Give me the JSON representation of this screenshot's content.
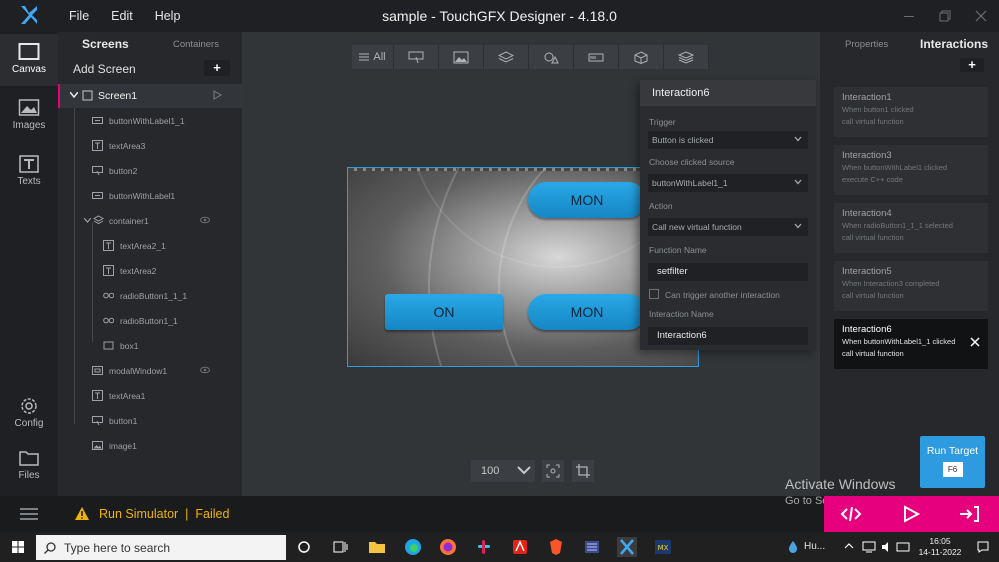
{
  "app": {
    "window_title": "sample - TouchGFX Designer - 4.18.0",
    "menu": [
      "File",
      "Edit",
      "Help"
    ]
  },
  "rail": {
    "items": [
      {
        "label": "Canvas",
        "icon": "canvas-icon"
      },
      {
        "label": "Images",
        "icon": "image-icon"
      },
      {
        "label": "Texts",
        "icon": "text-icon"
      },
      {
        "label": "Config",
        "icon": "gear-icon"
      },
      {
        "label": "Files",
        "icon": "folder-icon"
      }
    ]
  },
  "screens_panel": {
    "tab_screens": "Screens",
    "tab_containers": "Containers",
    "add_screen": "Add Screen",
    "add_symbol": "+",
    "tree": [
      {
        "label": "Screen1",
        "icon": "screen-icon",
        "selected": true
      },
      {
        "label": "buttonWithLabel1_1",
        "icon": "button-label-icon"
      },
      {
        "label": "textArea3",
        "icon": "textarea-icon"
      },
      {
        "label": "button2",
        "icon": "button-icon"
      },
      {
        "label": "buttonWithLabel1",
        "icon": "button-label-icon"
      },
      {
        "label": "container1",
        "icon": "container-icon"
      },
      {
        "label": "textArea2_1",
        "icon": "textarea-icon"
      },
      {
        "label": "textArea2",
        "icon": "textarea-icon"
      },
      {
        "label": "radioButton1_1_1",
        "icon": "radio-icon"
      },
      {
        "label": "radioButton1_1",
        "icon": "radio-icon"
      },
      {
        "label": "box1",
        "icon": "box-icon"
      },
      {
        "label": "modalWindow1",
        "icon": "modal-icon"
      },
      {
        "label": "textArea1",
        "icon": "textarea-icon"
      },
      {
        "label": "button1",
        "icon": "button-icon"
      },
      {
        "label": "image1",
        "icon": "image-icon"
      }
    ]
  },
  "toolbar": {
    "all_label": "All"
  },
  "stage": {
    "buttons": [
      "MON",
      "ON",
      "MON"
    ]
  },
  "zoom": {
    "value": "100"
  },
  "editor": {
    "title": "Interaction6",
    "trigger_label": "Trigger",
    "trigger_value": "Button is clicked",
    "source_label": "Choose clicked source",
    "source_value": "buttonWithLabel1_1",
    "action_label": "Action",
    "action_value": "Call new virtual function",
    "function_label": "Function Name",
    "function_value": "setfilter",
    "check_label": "Can trigger another interaction",
    "name_label": "Interaction Name",
    "name_value": "Interaction6"
  },
  "right_panel": {
    "tab_properties": "Properties",
    "tab_interactions": "Interactions",
    "add_symbol": "+",
    "interactions": [
      {
        "name": "Interaction1",
        "line1": "When button1 clicked",
        "line2": "call virtual function"
      },
      {
        "name": "Interaction3",
        "line1": "When buttonWithLabel1 clicked",
        "line2": "execute C++ code"
      },
      {
        "name": "Interaction4",
        "line1": "When radioButton1_1_1 selected",
        "line2": "call virtual function"
      },
      {
        "name": "Interaction5",
        "line1": "When Interaction3 completed",
        "line2": "call virtual function"
      },
      {
        "name": "Interaction6",
        "line1": "When buttonWithLabel1_1 clicked",
        "line2": "call virtual function",
        "selected": true
      }
    ],
    "run_target": "Run Target",
    "run_target_key": "F6"
  },
  "status": {
    "run_simulator": "Run Simulator",
    "separator": "|",
    "result": "Failed",
    "activate_title": "Activate Windows",
    "activate_sub": "Go to Settings to activate Windows."
  },
  "taskbar": {
    "search_placeholder": "Type here to search",
    "weather": "Hu...",
    "time": "16:05",
    "date": "14-11-2022"
  },
  "colors": {
    "accent_blue": "#2e9be0",
    "accent_pink": "#e6007e",
    "warning": "#f0b400"
  }
}
